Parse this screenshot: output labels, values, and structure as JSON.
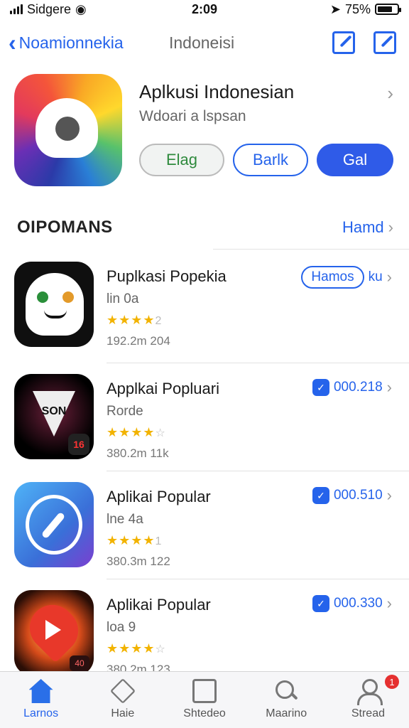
{
  "status_bar": {
    "carrier": "Sidgere",
    "time": "2:09",
    "battery": "75%"
  },
  "nav": {
    "back_label": "Noamionnekia",
    "title": "Indoneisi"
  },
  "header_app": {
    "title": "Aplkusi Indonesian",
    "subtitle": "Wdoari a lspsan",
    "buttons": [
      "Elag",
      "Barlk",
      "Gal"
    ]
  },
  "section": {
    "title": "OIPOMANS",
    "link": "Hamd"
  },
  "apps": [
    {
      "title": "Puplkasi Popekia",
      "subtitle": "lin 0a",
      "stars": "★★★★",
      "rating_suffix": "2",
      "meta": "192.2m 204",
      "action": "Hamos",
      "action_extra": "ku"
    },
    {
      "title": "Applkai Popluari",
      "subtitle": "Rorde",
      "stars": "★★★★",
      "rating_suffix": "☆",
      "meta": "380.2m 11k",
      "action": "000.218",
      "icon_text": "SON",
      "icon_badge": "16"
    },
    {
      "title": "Aplikai Popular",
      "subtitle": "lne 4a",
      "stars": "★★★★",
      "rating_suffix": "1",
      "meta": "380.3m 122",
      "action": "000.510"
    },
    {
      "title": "Aplikai Popular",
      "subtitle": "loa 9",
      "stars": "★★★★",
      "rating_suffix": "☆",
      "meta": "380.2m 123",
      "action": "000.330",
      "icon_badge": "40"
    }
  ],
  "tabs": [
    {
      "label": "Larnos",
      "icon": "home-icon",
      "active": true
    },
    {
      "label": "Haie",
      "icon": "diamond-icon"
    },
    {
      "label": "Shtedeo",
      "icon": "box-icon"
    },
    {
      "label": "Maarino",
      "icon": "search-icon"
    },
    {
      "label": "Stread",
      "icon": "person-icon",
      "badge": "1"
    }
  ],
  "colors": {
    "accent": "#2563eb",
    "primary_button": "#2f5be8",
    "star": "#f2b300",
    "badge": "#e53030"
  }
}
